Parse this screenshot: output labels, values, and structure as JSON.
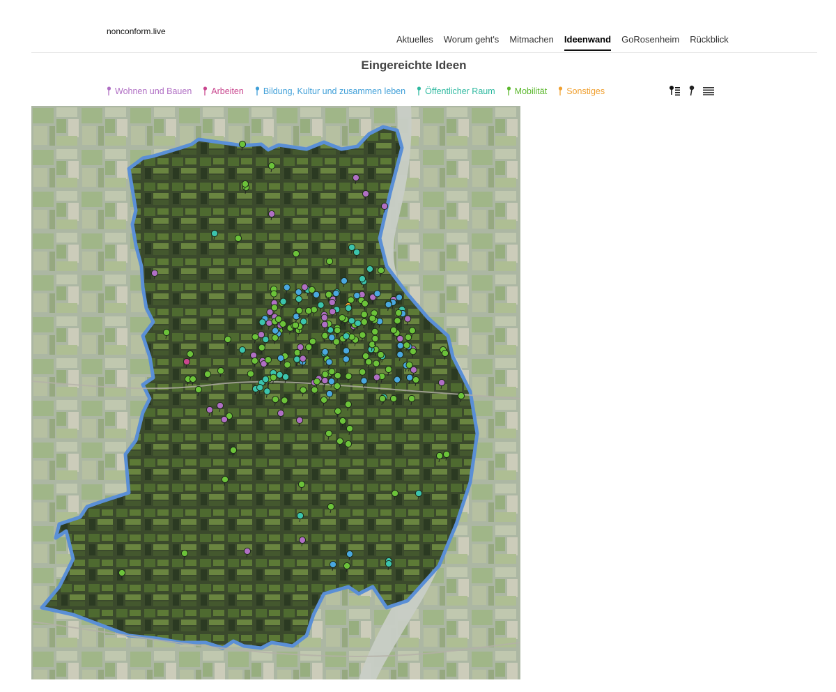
{
  "header": {
    "brand": "nonconform.live",
    "nav": [
      {
        "label": "Aktuelles",
        "active": false
      },
      {
        "label": "Worum geht's",
        "active": false
      },
      {
        "label": "Mitmachen",
        "active": false
      },
      {
        "label": "Ideenwand",
        "active": true
      },
      {
        "label": "GoRosenheim",
        "active": false
      },
      {
        "label": "Rückblick",
        "active": false
      }
    ]
  },
  "page": {
    "title": "Eingereichte Ideen"
  },
  "legend": [
    {
      "label": "Wohnen und Bauen",
      "color": "#b06fc4"
    },
    {
      "label": "Arbeiten",
      "color": "#c9478f"
    },
    {
      "label": "Bildung, Kultur und zusammen leben",
      "color": "#3f9fd8"
    },
    {
      "label": "Öffentlicher Raum",
      "color": "#2fb9a0"
    },
    {
      "label": "Mobilität",
      "color": "#5cb82e"
    },
    {
      "label": "Sonstiges",
      "color": "#f0a030"
    }
  ],
  "view_toggles": [
    "map-list-icon",
    "map-pin-icon",
    "list-icon"
  ],
  "map": {
    "boundary_color": "#5a8fd6",
    "river_color": "#c9cfc9",
    "marker_colors": {
      "wohnen": "#b06fc4",
      "arbeiten": "#c9478f",
      "bildung": "#4aa8e0",
      "raum": "#3cc4ad",
      "mobilitaet": "#6cc33a",
      "sonstiges": "#f4a73a"
    }
  }
}
